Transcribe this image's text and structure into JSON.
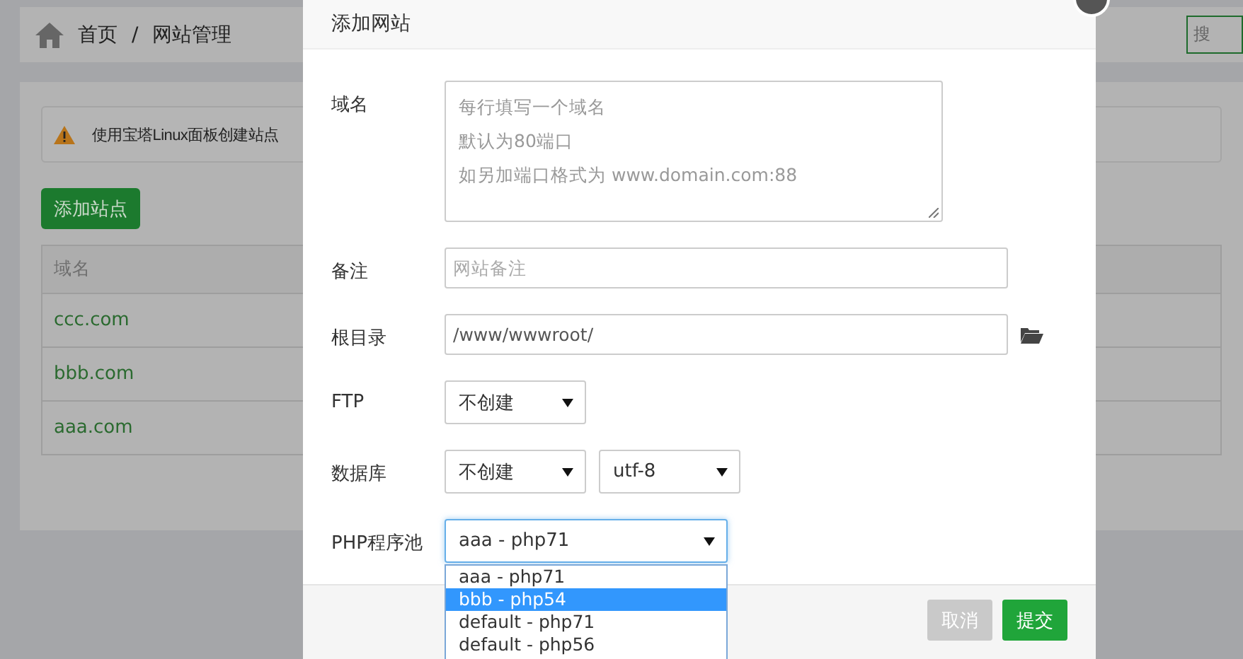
{
  "breadcrumb": {
    "items": [
      "首页",
      "网站管理"
    ],
    "separator": "/"
  },
  "search_button": "搜",
  "notice": "使用宝塔Linux面板创建站点",
  "add_site_button": "添加站点",
  "table": {
    "columns": [
      "域名"
    ],
    "rows": [
      {
        "domain": "ccc.com"
      },
      {
        "domain": "bbb.com"
      },
      {
        "domain": "aaa.com"
      }
    ]
  },
  "dialog": {
    "title": "添加网站",
    "fields": [
      {
        "kind": "textarea",
        "label": "域名",
        "placeholder_lines": [
          "每行填写一个域名",
          "默认为80端口",
          "如另加端口格式为 www.domain.com:88"
        ]
      },
      {
        "kind": "input",
        "label": "备注",
        "placeholder": "网站备注"
      },
      {
        "kind": "path",
        "label": "根目录",
        "value": "/www/wwwroot/"
      },
      {
        "kind": "select",
        "label": "FTP",
        "selects": [
          {
            "value": "不创建",
            "open": false
          }
        ]
      },
      {
        "kind": "select",
        "label": "数据库",
        "selects": [
          {
            "value": "不创建",
            "open": false
          },
          {
            "value": "utf-8",
            "open": false
          }
        ]
      },
      {
        "kind": "select",
        "label": "PHP程序池",
        "selects": [
          {
            "value": "aaa - php71",
            "open": true,
            "options": [
              {
                "label": "aaa - php71",
                "highlighted": false
              },
              {
                "label": "bbb - php54",
                "highlighted": true
              },
              {
                "label": "default - php71",
                "highlighted": false
              },
              {
                "label": "default - php56",
                "highlighted": false
              }
            ]
          }
        ]
      }
    ],
    "buttons": [
      {
        "label": "取消",
        "kind": "cancel"
      },
      {
        "label": "提交",
        "kind": "submit"
      }
    ]
  }
}
